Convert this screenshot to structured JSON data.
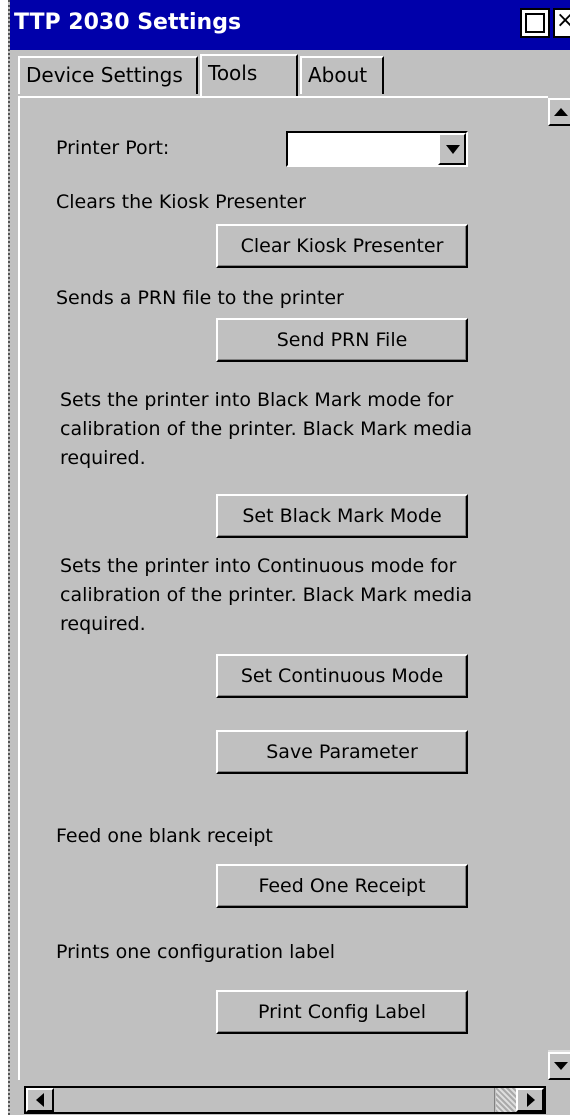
{
  "window": {
    "title": "TTP 2030 Settings",
    "close_glyph": "×"
  },
  "tabs": [
    {
      "label": "Device Settings",
      "selected": false
    },
    {
      "label": "Tools",
      "selected": true
    },
    {
      "label": "About",
      "selected": false
    }
  ],
  "tools": {
    "printer_port": {
      "label": "Printer Port:",
      "value": ""
    },
    "clear_kiosk": {
      "description": "Clears the Kiosk Presenter",
      "button": "Clear Kiosk Presenter"
    },
    "send_prn": {
      "description": "Sends a PRN file to the printer",
      "button": "Send PRN File"
    },
    "black_mark": {
      "description": "Sets the printer into Black Mark mode for calibration of the printer. Black Mark media required.",
      "button": "Set Black Mark Mode"
    },
    "continuous": {
      "description": "Sets the printer into Continuous mode for calibration of the printer. Black Mark media required.",
      "button": "Set Continuous Mode"
    },
    "save_parameter": {
      "button": "Save Parameter"
    },
    "feed_receipt": {
      "description": "Feed one blank receipt",
      "button": "Feed One Receipt"
    },
    "config_label": {
      "description": "Prints one configuration label",
      "button": "Print Config Label"
    }
  },
  "colors": {
    "titlebar": "#0000aa",
    "face": "#c0c0c0"
  },
  "icons": {
    "maximize": "maximize-icon",
    "close": "close-icon",
    "dropdown": "chevron-down-icon",
    "scroll_up": "arrow-up-icon",
    "scroll_down": "arrow-down-icon",
    "scroll_left": "arrow-left-icon",
    "scroll_right": "arrow-right-icon"
  }
}
